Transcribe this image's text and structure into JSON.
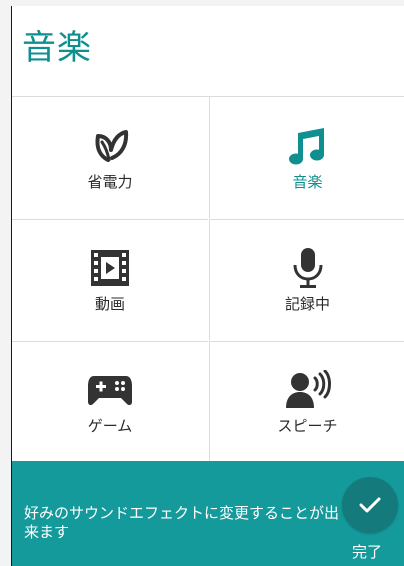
{
  "dialog": {
    "title": "音楽"
  },
  "modes": [
    {
      "label": "省電力",
      "icon": "leaf-icon",
      "selected": false
    },
    {
      "label": "音楽",
      "icon": "music-note-icon",
      "selected": true
    },
    {
      "label": "動画",
      "icon": "film-icon",
      "selected": false
    },
    {
      "label": "記録中",
      "icon": "microphone-icon",
      "selected": false
    },
    {
      "label": "ゲーム",
      "icon": "gamepad-icon",
      "selected": false
    },
    {
      "label": "スピーチ",
      "icon": "speaker-person-icon",
      "selected": false
    }
  ],
  "footer": {
    "message": "好みのサウンドエフェクトに変更することが出来ます",
    "done_label": "完了"
  },
  "colors": {
    "accent": "#0f8f8f",
    "footer_bg": "#159a9b",
    "done_button_bg": "#157a7b",
    "icon_dark": "#333333"
  }
}
